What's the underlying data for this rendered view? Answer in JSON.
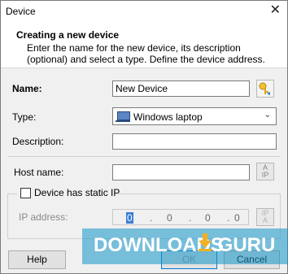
{
  "window": {
    "title": "Device",
    "close_glyph": "✕"
  },
  "header": {
    "title": "Creating a new device",
    "description": "Enter the name for the new device, its description (optional) and select a type. Define the device address."
  },
  "form": {
    "name_label": "Name:",
    "name_value": "New Device",
    "type_label": "Type:",
    "type_value": "Windows laptop",
    "type_icon": "laptop-icon",
    "description_label": "Description:",
    "description_value": "",
    "host_label": "Host name:",
    "host_value": "",
    "static_ip_label": "Device has static IP",
    "static_ip_checked": false,
    "ip_label": "IP address:",
    "ip_segments": [
      "0",
      "0",
      "0",
      "0"
    ]
  },
  "side_buttons": {
    "name_key_icon": "key-icon",
    "host_icon": "resolve-ip-icon",
    "ip_icon": "resolve-host-icon",
    "ab_label": "A",
    "ip_label": "IP"
  },
  "buttons": {
    "help": "Help",
    "ok": "OK",
    "cancel": "Cancel"
  },
  "watermark": {
    "text_left": "DOWNLOADS",
    "text_right": ".GURU"
  },
  "colors": {
    "accent": "#0078d7",
    "watermark": "#1496c8",
    "arrow": "#f2b01e"
  }
}
